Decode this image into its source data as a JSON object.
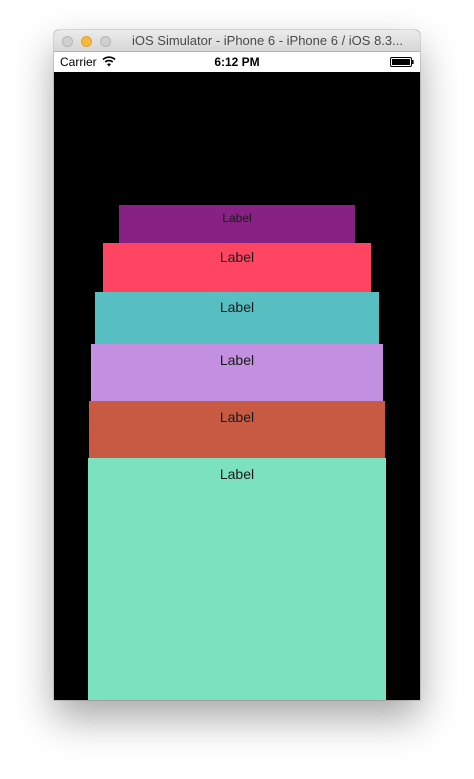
{
  "window": {
    "title": "iOS Simulator - iPhone 6 - iPhone 6 / iOS 8.3..."
  },
  "status_bar": {
    "carrier": "Carrier",
    "time": "6:12 PM",
    "wifi_icon": "wifi-icon",
    "battery_icon": "battery-full-icon"
  },
  "cards": [
    {
      "label": "Label",
      "color": "#872183"
    },
    {
      "label": "Label",
      "color": "#ff4561"
    },
    {
      "label": "Label",
      "color": "#57bec1"
    },
    {
      "label": "Label",
      "color": "#c38fe1"
    },
    {
      "label": "Label",
      "color": "#c85a43"
    },
    {
      "label": "Label",
      "color": "#7be1be"
    }
  ],
  "colors": {
    "screen_background": "#000000",
    "minimize_button": "#f5b93f"
  }
}
